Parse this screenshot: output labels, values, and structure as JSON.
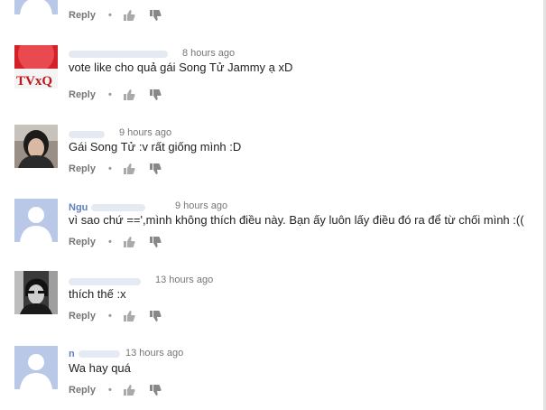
{
  "comments": [
    {
      "author": "",
      "time": "",
      "text": "",
      "reply": "Reply"
    },
    {
      "author": "",
      "time": "8 hours ago",
      "text": "vote like cho quả gái Song Tử Jammy ạ xD",
      "reply": "Reply",
      "avatar_text": "TVxQ"
    },
    {
      "author": "",
      "time": "9 hours ago",
      "text": "Gái Song Tử :v rất giống mình :D",
      "reply": "Reply"
    },
    {
      "author": "Ngu",
      "time": "9 hours ago",
      "text": "vì sao chứ ==',mình không thích điều này. Bạn ấy luôn lấy điều đó ra để từ chối mình :((",
      "reply": "Reply"
    },
    {
      "author": "",
      "time": "13 hours ago",
      "text": "thích thế :x",
      "reply": "Reply"
    },
    {
      "author": "n",
      "time": "13 hours ago",
      "text": "Wa hay quá",
      "reply": "Reply"
    }
  ],
  "colors": {
    "author": "#5f7fbf",
    "meta": "#767676",
    "default_avatar_bg": "#b8c8e6",
    "default_avatar_fg": "#ffffff"
  },
  "icons": [
    "thumb-up-icon",
    "thumb-down-icon",
    "default-avatar-icon"
  ]
}
